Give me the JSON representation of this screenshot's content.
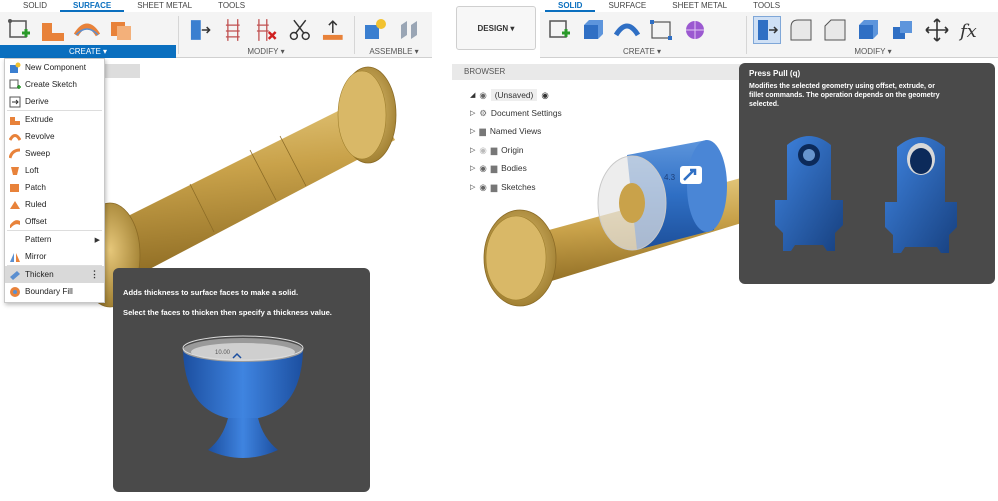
{
  "left": {
    "tabs": [
      {
        "label": "SOLID",
        "active": false
      },
      {
        "label": "SURFACE",
        "active": true
      },
      {
        "label": "SHEET METAL",
        "active": false
      },
      {
        "label": "TOOLS",
        "active": false
      }
    ],
    "groups": {
      "create": "CREATE ▾",
      "modify": "MODIFY ▾",
      "assemble": "ASSEMBLE ▾"
    },
    "create_menu": [
      {
        "label": "New Component",
        "icon": "new-component-icon"
      },
      {
        "label": "Create Sketch",
        "icon": "create-sketch-icon"
      },
      {
        "label": "Derive",
        "icon": "derive-icon"
      },
      {
        "label": "Extrude",
        "icon": "extrude-icon"
      },
      {
        "label": "Revolve",
        "icon": "revolve-icon"
      },
      {
        "label": "Sweep",
        "icon": "sweep-icon"
      },
      {
        "label": "Loft",
        "icon": "loft-icon"
      },
      {
        "label": "Patch",
        "icon": "patch-icon"
      },
      {
        "label": "Ruled",
        "icon": "ruled-icon"
      },
      {
        "label": "Offset",
        "icon": "offset-icon"
      },
      {
        "label": "Pattern",
        "icon": "pattern-icon"
      },
      {
        "label": "Mirror",
        "icon": "mirror-icon"
      },
      {
        "label": "Thicken",
        "icon": "thicken-icon"
      },
      {
        "label": "Boundary Fill",
        "icon": "boundary-fill-icon"
      }
    ],
    "tooltip": {
      "line1": "Adds thickness to surface faces to make a solid.",
      "line2": "Select the faces to thicken then specify a thickness value.",
      "dimension": "10.00"
    }
  },
  "right": {
    "design_button": "DESIGN ▾",
    "tabs": [
      {
        "label": "SOLID",
        "active": true
      },
      {
        "label": "SURFACE",
        "active": false
      },
      {
        "label": "SHEET METAL",
        "active": false
      },
      {
        "label": "TOOLS",
        "active": false
      }
    ],
    "groups": {
      "create": "CREATE ▾",
      "modify": "MODIFY ▾"
    },
    "browser": {
      "title": "BROWSER",
      "root": "(Unsaved)",
      "items": [
        "Document Settings",
        "Named Views",
        "Origin",
        "Bodies",
        "Sketches"
      ]
    },
    "dimension": "4.3",
    "tooltip": {
      "title": "Press Pull (q)",
      "line1": "Modifies the selected geometry using offset, extrude, or",
      "line2": "fillet commands. The operation depends on the geometry",
      "line3": "selected."
    }
  },
  "colors": {
    "accent": "#0a6fbf",
    "tooltip_bg": "#4a4a4a",
    "model_brass": "#c9a24a",
    "model_blue": "#2f6fc4",
    "highlight_box": "#e03030"
  }
}
